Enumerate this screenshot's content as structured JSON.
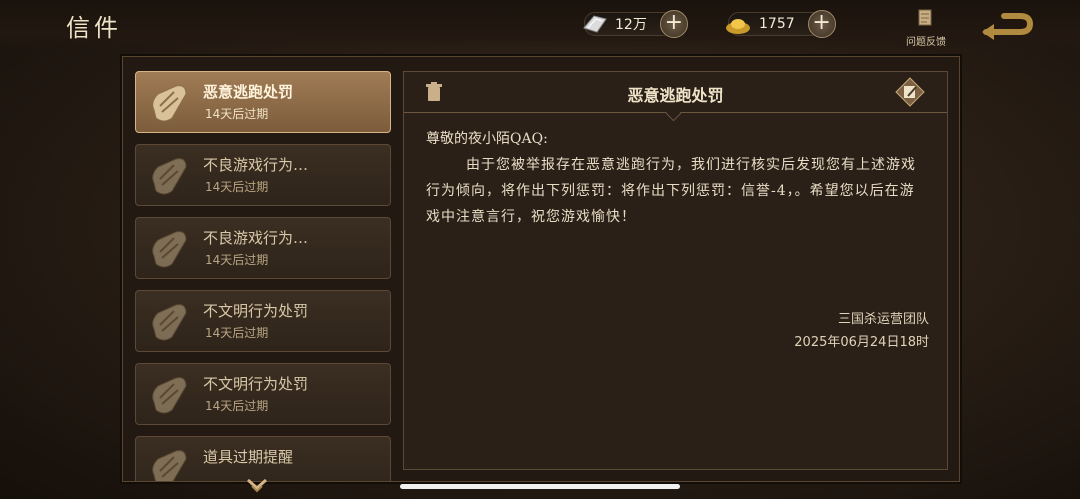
{
  "header": {
    "title": "信件",
    "currency1": "12万",
    "currency2": "1757",
    "feedback_label": "问题反馈"
  },
  "mail_list": [
    {
      "title": "恶意逃跑处罚",
      "expiry": "14天后过期",
      "active": true
    },
    {
      "title": "不良游戏行为…",
      "expiry": "14天后过期",
      "active": false
    },
    {
      "title": "不良游戏行为…",
      "expiry": "14天后过期",
      "active": false
    },
    {
      "title": "不文明行为处罚",
      "expiry": "14天后过期",
      "active": false
    },
    {
      "title": "不文明行为处罚",
      "expiry": "14天后过期",
      "active": false
    },
    {
      "title": "道具过期提醒",
      "expiry": "",
      "active": false
    }
  ],
  "detail": {
    "title": "恶意逃跑处罚",
    "greeting": "尊敬的夜小陌QAQ:",
    "content": "由于您被举报存在恶意逃跑行为，我们进行核实后发现您有上述游戏行为倾向，将作出下列惩罚：将作出下列惩罚：信誉-4，。希望您以后在游戏中注意言行，祝您游戏愉快！",
    "signature": "三国杀运营团队",
    "date": "2025年06月24日18时"
  },
  "colors": {
    "accent_gold": "#d6b487",
    "panel_bg": "#2a2018"
  },
  "icons": [
    "silver-icon",
    "gold-ingot-icon",
    "plus-icon",
    "feedback-scroll-icon",
    "back-arrow-icon",
    "scroll-icon",
    "trash-icon",
    "edit-icon",
    "chevron-down-icon"
  ]
}
